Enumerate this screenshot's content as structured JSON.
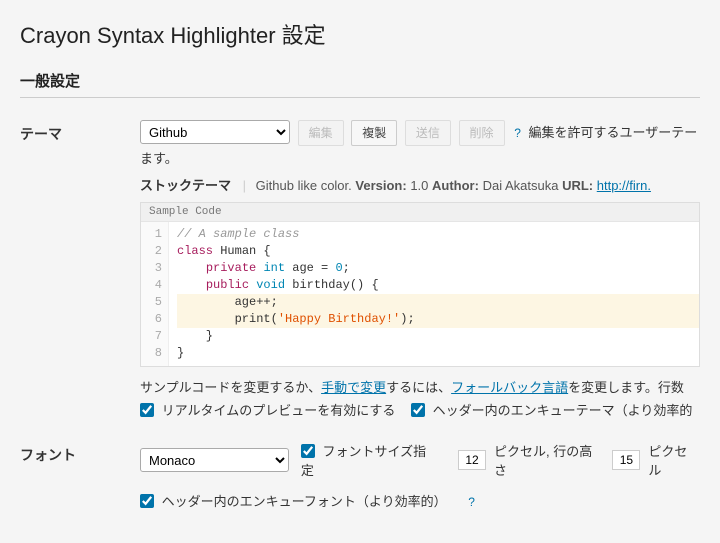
{
  "page": {
    "title": "Crayon Syntax Highlighter 設定",
    "section_general": "一般設定"
  },
  "theme": {
    "label": "テーマ",
    "select_value": "Github",
    "btn_edit": "編集",
    "btn_dup": "複製",
    "btn_send": "送信",
    "btn_del": "削除",
    "edit_allow": "編集を許可するユーザーテー",
    "allow_suffix": "ます。",
    "stock_label": "ストックテーマ",
    "stock_desc": "Github like color.",
    "version_k": "Version:",
    "version_v": "1.0",
    "author_k": "Author:",
    "author_v": "Dai Akatsuka",
    "url_k": "URL:",
    "url_v": "http://firn."
  },
  "preview": {
    "title": "Sample Code",
    "lines": [
      {
        "hl": false,
        "segments": [
          {
            "t": "// A sample class",
            "c": "c-comment"
          }
        ]
      },
      {
        "hl": false,
        "segments": [
          {
            "t": "class",
            "c": "c-kw"
          },
          {
            "t": " "
          },
          {
            "t": "Human",
            "c": "c-id"
          },
          {
            "t": " {"
          }
        ]
      },
      {
        "hl": false,
        "segments": [
          {
            "t": "    "
          },
          {
            "t": "private",
            "c": "c-kw"
          },
          {
            "t": " "
          },
          {
            "t": "int",
            "c": "c-type"
          },
          {
            "t": " age = "
          },
          {
            "t": "0",
            "c": "c-num"
          },
          {
            "t": ";"
          }
        ]
      },
      {
        "hl": false,
        "segments": [
          {
            "t": "    "
          },
          {
            "t": "public",
            "c": "c-kw"
          },
          {
            "t": " "
          },
          {
            "t": "void",
            "c": "c-type"
          },
          {
            "t": " "
          },
          {
            "t": "birthday",
            "c": "c-fn"
          },
          {
            "t": "() {"
          }
        ]
      },
      {
        "hl": true,
        "segments": [
          {
            "t": "        age++;"
          }
        ]
      },
      {
        "hl": true,
        "segments": [
          {
            "t": "        print("
          },
          {
            "t": "'Happy Birthday!'",
            "c": "c-str"
          },
          {
            "t": ");"
          }
        ]
      },
      {
        "hl": false,
        "segments": [
          {
            "t": "    }"
          }
        ]
      },
      {
        "hl": false,
        "segments": [
          {
            "t": "}"
          }
        ]
      }
    ],
    "below_text_a": "サンプルコードを変更するか、",
    "below_link_1": "手動で変更",
    "below_text_b": "するには、",
    "below_link_2": "フォールバック言語",
    "below_text_c": "を変更します。行数",
    "chk_realtime": "リアルタイムのプレビューを有効にする",
    "chk_enqueue_theme": "ヘッダー内のエンキューテーマ（より効率的"
  },
  "font": {
    "label": "フォント",
    "select_value": "Monaco",
    "chk_size": "フォントサイズ指定",
    "size_val": "12",
    "px_label": "ピクセル, 行の高さ",
    "lineheight_val": "15",
    "px_trail": "ピクセル",
    "chk_enqueue_font": "ヘッダー内のエンキューフォント（より効率的）"
  }
}
